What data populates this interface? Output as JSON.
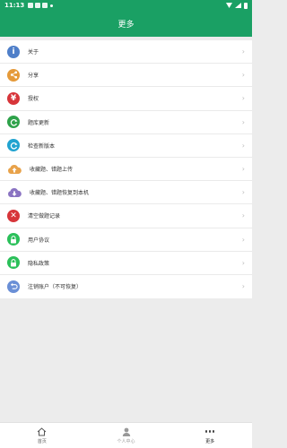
{
  "status_bar": {
    "time": "11:13"
  },
  "header": {
    "title": "更多"
  },
  "menu": [
    {
      "label": "关于",
      "icon": "info-icon",
      "color": "#4f7fc9",
      "glyph": "i"
    },
    {
      "label": "分享",
      "icon": "share-icon",
      "color": "#e59a3a",
      "glyph": "<"
    },
    {
      "label": "授权",
      "icon": "yen-icon",
      "color": "#d7353a",
      "glyph": "¥"
    },
    {
      "label": "题库更新",
      "icon": "refresh-icon",
      "color": "#2ea24a",
      "glyph": "C"
    },
    {
      "label": "检查新版本",
      "icon": "check-version-icon",
      "color": "#21a3d0",
      "glyph": "C"
    },
    {
      "label": "收藏题、错题上传",
      "icon": "cloud-upload-icon",
      "color": "#e8a24a",
      "glyph": ""
    },
    {
      "label": "收藏题、错题恢复到本机",
      "icon": "cloud-download-icon",
      "color": "#8a73c2",
      "glyph": ""
    },
    {
      "label": "清空做题记录",
      "icon": "clear-icon",
      "color": "#d7353a",
      "glyph": "✕"
    },
    {
      "label": "用户协议",
      "icon": "lock-icon",
      "color": "#2bc05a",
      "glyph": "🔒"
    },
    {
      "label": "隐私政策",
      "icon": "lock-icon",
      "color": "#2bc05a",
      "glyph": "🔒"
    },
    {
      "label": "注销账户（不可恢复）",
      "icon": "undo-icon",
      "color": "#6a8fd6",
      "glyph": "↺"
    }
  ],
  "tabs": [
    {
      "label": "首页",
      "icon": "home-icon"
    },
    {
      "label": "个人中心",
      "icon": "person-icon"
    },
    {
      "label": "更多",
      "icon": "more-icon"
    }
  ]
}
